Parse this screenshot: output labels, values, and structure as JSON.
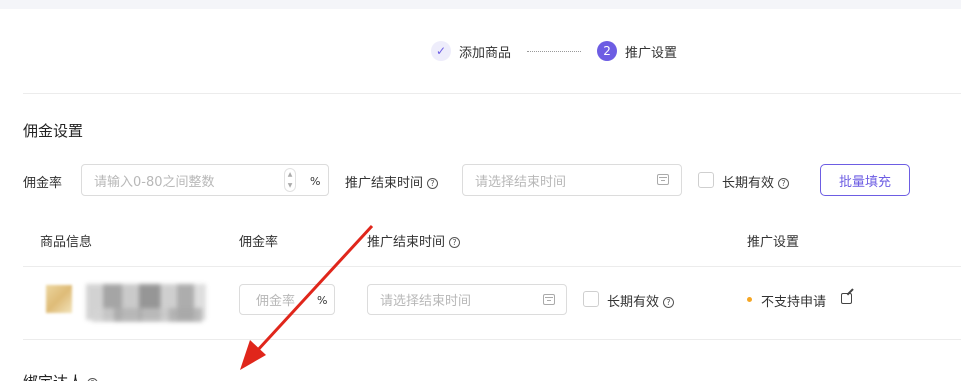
{
  "steps": {
    "step1_label": "添加商品",
    "step2_number": "2",
    "step2_label": "推广设置"
  },
  "commission_section": {
    "title": "佣金设置",
    "rate_label": "佣金率",
    "rate_placeholder": "请输入0-80之间整数",
    "rate_unit": "%",
    "end_time_label": "推广结束时间",
    "end_time_placeholder": "请选择结束时间",
    "long_term_label": "长期有效",
    "batch_fill_label": "批量填充"
  },
  "table": {
    "headers": {
      "product_info": "商品信息",
      "commission_rate": "佣金率",
      "end_time": "推广结束时间",
      "promo_settings": "推广设置"
    },
    "row": {
      "rate_placeholder": "佣金率",
      "rate_unit": "%",
      "end_time_placeholder": "请选择结束时间",
      "long_term_label": "长期有效",
      "status_text": "不支持申请"
    }
  },
  "bottom_section": {
    "title": "绑定达人"
  },
  "colors": {
    "accent": "#6d5de3",
    "status_dot": "#f5a623",
    "annotation_arrow": "#e0261b"
  },
  "icons": {
    "step_done": "check-icon",
    "help": "question-circle-icon",
    "calendar": "calendar-icon",
    "edit": "edit-icon"
  }
}
